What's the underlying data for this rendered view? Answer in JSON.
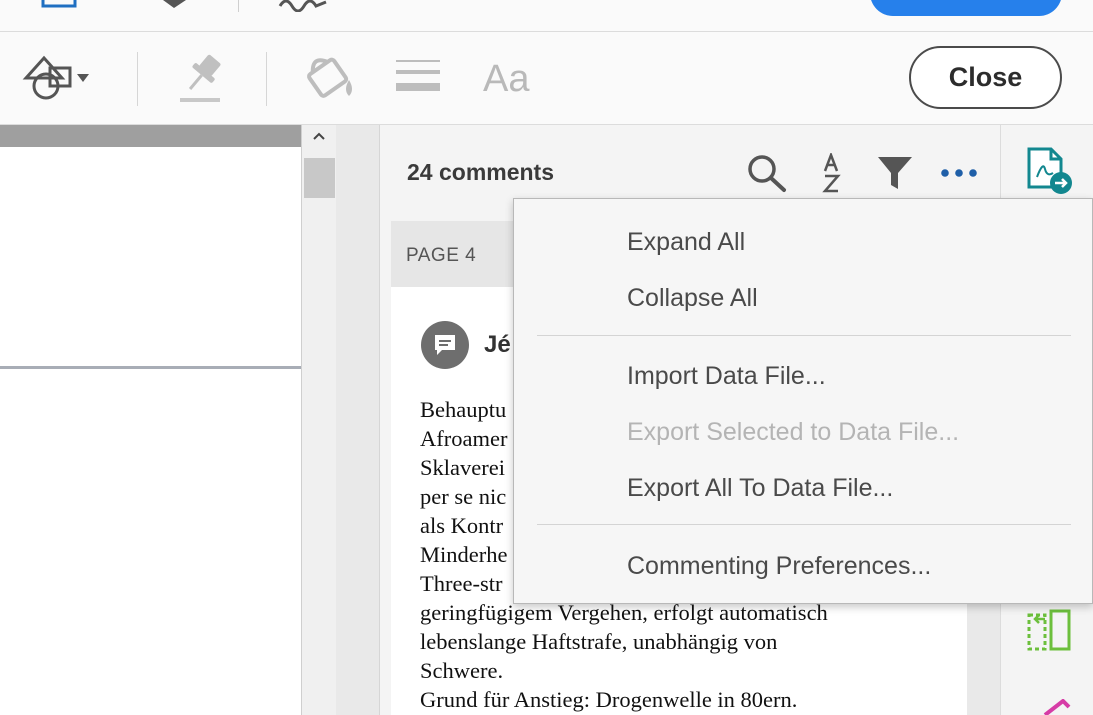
{
  "toolbar": {
    "text_tool_label": "Aa",
    "close_label": "Close"
  },
  "comments": {
    "count_label": "24 comments",
    "page_label": "PAGE 4",
    "items": [
      {
        "author": "Jé",
        "lines": [
          "Behauptu",
          "Afroamer",
          "Sklaverei",
          "per se nic",
          "als Kontr",
          "Minderhe",
          "Three-str",
          "geringfügigem Vergehen, erfolgt automatisch",
          "lebenslange Haftstrafe, unabhängig von",
          "Schwere.",
          "Grund für Anstieg: Drogenwelle in 80ern."
        ]
      }
    ]
  },
  "options_menu": {
    "expand_all": "Expand All",
    "collapse_all": "Collapse All",
    "import_data_file": "Import Data File...",
    "export_selected": "Export Selected to Data File...",
    "export_all": "Export All To Data File...",
    "commenting_preferences": "Commenting Preferences..."
  },
  "colors": {
    "accent_blue": "#2680eb",
    "icon_dark": "#555555",
    "icon_muted": "#b9b9b9",
    "link_blue": "#1f5fa8",
    "export_teal": "#12878f",
    "organize_green": "#6cbf3c",
    "edit_pink": "#d63ca6"
  },
  "icons": {
    "shapes": "shapes-icon",
    "pin": "pin-icon",
    "fill": "fill-bucket-icon",
    "lines": "line-thickness-icon",
    "search": "search-icon",
    "sort": "sort-az-icon",
    "filter": "filter-icon",
    "more": "more-options-icon",
    "export_pdf": "export-pdf-icon",
    "organize": "organize-pages-icon"
  }
}
